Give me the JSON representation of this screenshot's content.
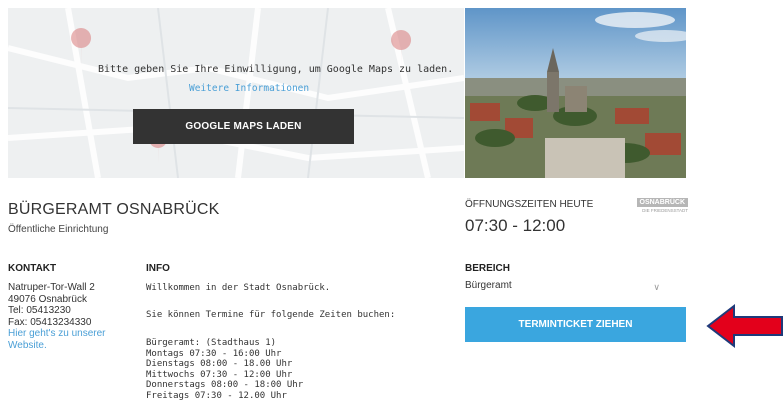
{
  "map": {
    "consent_text": "Bitte geben Sie Ihre Einwilligung, um Google Maps zu laden.",
    "more_info_link": "Weitere Informationen",
    "load_button": "GOOGLE MAPS LADEN"
  },
  "office": {
    "title": "BÜRGERAMT OSNABRÜCK",
    "subtitle": "Öffentliche Einrichtung"
  },
  "contact": {
    "heading": "KONTAKT",
    "street": "Natruper-Tor-Wall 2",
    "city": "49076 Osnabrück",
    "tel": "Tel: 05413230",
    "fax": "Fax: 05413234330",
    "website_link_1": "Hier geht's zu unserer",
    "website_link_2": "Website."
  },
  "info": {
    "heading": "INFO",
    "welcome": "Willkommen in der Stadt Osnabrück.",
    "booking": "Sie können Termine für folgende Zeiten buchen:",
    "hours_title": "Bürgeramt: (Stadthaus 1)",
    "days": [
      "Montags 07:30 - 16:00 Uhr",
      "Dienstags 08:00 - 18.00 Uhr",
      "Mittwochs 07:30 - 12:00 Uhr",
      "Donnerstags 08:00 - 18:00 Uhr",
      "Freitags 07:30 - 12.00 Uhr"
    ]
  },
  "opening": {
    "label": "ÖFFNUNGSZEITEN HEUTE",
    "value": "07:30 - 12:00"
  },
  "logo": {
    "name": "OSNABRÜCK",
    "tagline": "DIE FRIEDENSSTADT"
  },
  "bereich": {
    "heading": "BEREICH",
    "selected": "Bürgeramt"
  },
  "ticket_button": "TERMINTICKET ZIEHEN",
  "colors": {
    "accent": "#3aa6df",
    "dark_button": "#333333",
    "arrow": "#e3001b",
    "arrow_outline": "#1f3a7a"
  }
}
